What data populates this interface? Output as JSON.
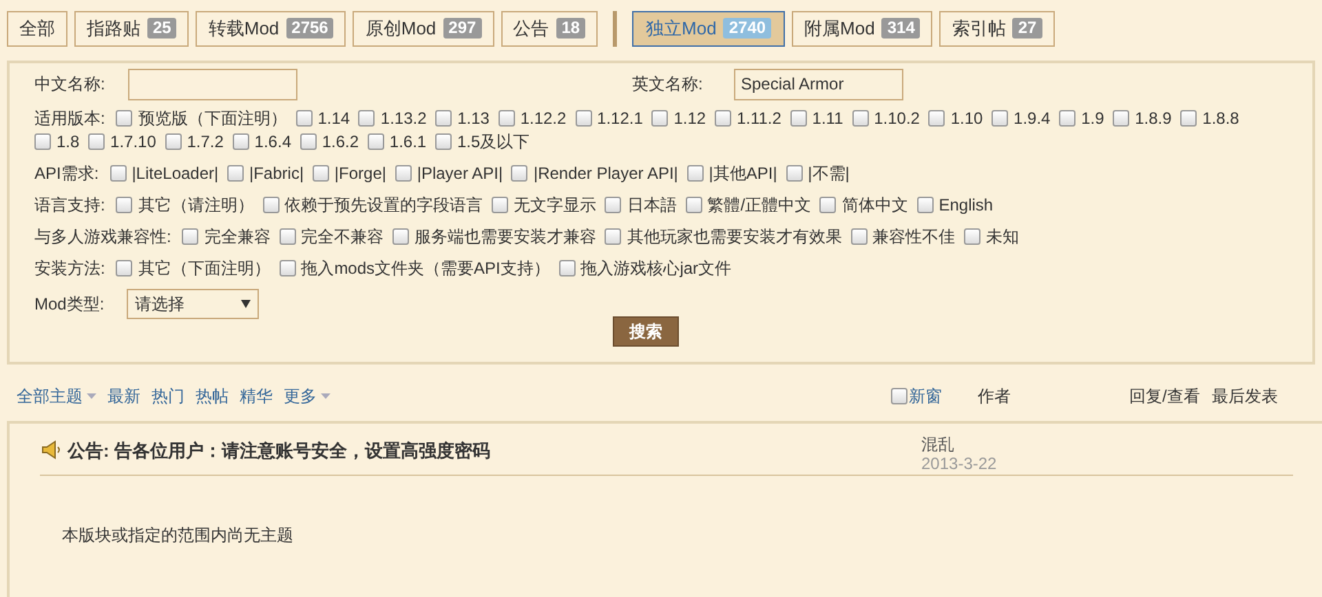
{
  "tabs": [
    {
      "label": "全部",
      "selected": false
    },
    {
      "label": "指路贴",
      "count": "25",
      "selected": false
    },
    {
      "label": "转载Mod",
      "count": "2756",
      "selected": false
    },
    {
      "label": "原创Mod",
      "count": "297",
      "selected": false
    },
    {
      "label": "公告",
      "count": "18",
      "selected": false
    },
    {
      "label": "独立Mod",
      "count": "2740",
      "selected": true,
      "group_start": true
    },
    {
      "label": "附属Mod",
      "count": "314",
      "selected": false
    },
    {
      "label": "索引帖",
      "count": "27",
      "selected": false
    }
  ],
  "filter": {
    "chinese_name": {
      "label": "中文名称:"
    },
    "english_name": {
      "label": "英文名称:",
      "value": "Special Armor"
    },
    "groups": [
      {
        "label": "适用版本:",
        "options": [
          {
            "label": "预览版（下面注明）",
            "checked": false
          },
          {
            "label": "1.14",
            "checked": false
          },
          {
            "label": "1.13.2",
            "checked": false
          },
          {
            "label": "1.13",
            "checked": false
          },
          {
            "label": "1.12.2",
            "checked": false
          },
          {
            "label": "1.12.1",
            "checked": false
          },
          {
            "label": "1.12",
            "checked": false
          },
          {
            "label": "1.11.2",
            "checked": false
          },
          {
            "label": "1.11",
            "checked": false
          },
          {
            "label": "1.10.2",
            "checked": false
          },
          {
            "label": "1.10",
            "checked": false
          },
          {
            "label": "1.9.4",
            "checked": false
          },
          {
            "label": "1.9",
            "checked": false
          },
          {
            "label": "1.8.9",
            "checked": false
          },
          {
            "label": "1.8.8",
            "checked": false
          },
          {
            "label": "1.8",
            "checked": false
          },
          {
            "label": "1.7.10",
            "checked": false
          },
          {
            "label": "1.7.2",
            "checked": false
          },
          {
            "label": "1.6.4",
            "checked": false
          },
          {
            "label": "1.6.2",
            "checked": false
          },
          {
            "label": "1.6.1",
            "checked": false
          },
          {
            "label": "1.5及以下",
            "checked": false
          }
        ]
      },
      {
        "label": "API需求:",
        "options": [
          {
            "label": "|LiteLoader|",
            "checked": false
          },
          {
            "label": "|Fabric|",
            "checked": false
          },
          {
            "label": "|Forge|",
            "checked": false
          },
          {
            "label": "|Player API|",
            "checked": false
          },
          {
            "label": "|Render Player API|",
            "checked": false
          },
          {
            "label": "|其他API|",
            "checked": false
          },
          {
            "label": "|不需|",
            "checked": false
          }
        ]
      },
      {
        "label": "语言支持:",
        "options": [
          {
            "label": "其它（请注明）",
            "checked": false
          },
          {
            "label": "依赖于预先设置的字段语言",
            "checked": false
          },
          {
            "label": "无文字显示",
            "checked": false
          },
          {
            "label": "日本語",
            "checked": false
          },
          {
            "label": "繁體/正體中文",
            "checked": false
          },
          {
            "label": "简体中文",
            "checked": false
          },
          {
            "label": "English",
            "checked": false
          }
        ]
      },
      {
        "label": "与多人游戏兼容性:",
        "options": [
          {
            "label": "完全兼容",
            "checked": false
          },
          {
            "label": "完全不兼容",
            "checked": false
          },
          {
            "label": "服务端也需要安装才兼容",
            "checked": false
          },
          {
            "label": "其他玩家也需要安装才有效果",
            "checked": false
          },
          {
            "label": "兼容性不佳",
            "checked": false
          },
          {
            "label": "未知",
            "checked": false
          }
        ]
      },
      {
        "label": "安装方法:",
        "options": [
          {
            "label": "其它（下面注明）",
            "checked": false
          },
          {
            "label": "拖入mods文件夹（需要API支持）",
            "checked": false
          },
          {
            "label": "拖入游戏核心jar文件",
            "checked": false
          }
        ]
      }
    ],
    "mod_type": {
      "label": "Mod类型:",
      "value": "请选择"
    },
    "search_button": "搜索"
  },
  "toolbar": {
    "links": [
      {
        "label": "全部主题",
        "dropdown": true
      },
      {
        "label": "最新",
        "dropdown": false
      },
      {
        "label": "热门",
        "dropdown": false
      },
      {
        "label": "热帖",
        "dropdown": false
      },
      {
        "label": "精华",
        "dropdown": false
      },
      {
        "label": "更多",
        "dropdown": true
      }
    ],
    "new_window": {
      "label": "新窗",
      "checked": false
    },
    "columns": [
      "作者",
      "回复/查看",
      "最后发表"
    ]
  },
  "announcement": {
    "title": "公告: 告各位用户：请注意账号安全，设置高强度密码",
    "author": "混乱",
    "date": "2013-3-22"
  },
  "empty_message": "本版块或指定的范围内尚无主题"
}
